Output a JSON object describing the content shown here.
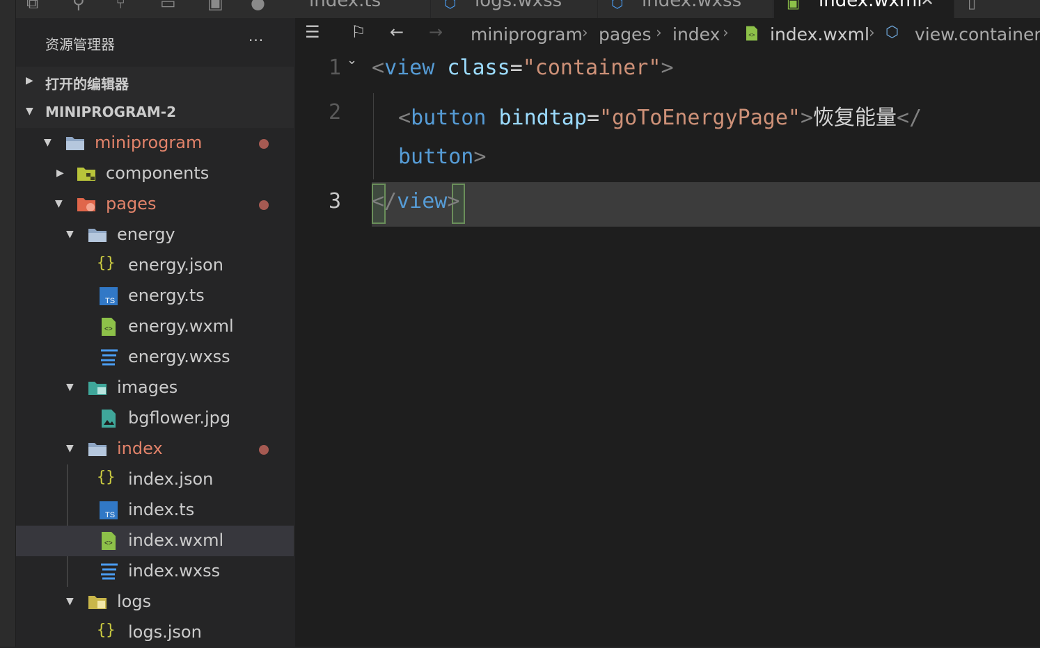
{
  "tabs": [
    {
      "label": "index.ts",
      "icon": "ts-file-icon",
      "active": false
    },
    {
      "label": "logs.wxss",
      "icon": "css-file-icon",
      "active": false
    },
    {
      "label": "index.wxss",
      "icon": "css-file-icon",
      "active": false
    },
    {
      "label": "index.wxml",
      "icon": "wxml-file-icon",
      "active": true,
      "close": "✕"
    }
  ],
  "explorer": {
    "title": "资源管理器",
    "more": "···",
    "open_editors": "打开的编辑器",
    "project": "MINIPROGRAM-2",
    "tree": [
      {
        "name": "miniprogram",
        "type": "folder",
        "modified": true
      },
      {
        "name": "components",
        "type": "folder"
      },
      {
        "name": "pages",
        "type": "folder",
        "modified": true
      },
      {
        "name": "energy",
        "type": "folder"
      },
      {
        "name": "energy.json",
        "type": "json"
      },
      {
        "name": "energy.ts",
        "type": "ts"
      },
      {
        "name": "energy.wxml",
        "type": "wxml"
      },
      {
        "name": "energy.wxss",
        "type": "wxss"
      },
      {
        "name": "images",
        "type": "folder"
      },
      {
        "name": "bgflower.jpg",
        "type": "image"
      },
      {
        "name": "index",
        "type": "folder",
        "modified": true
      },
      {
        "name": "index.json",
        "type": "json"
      },
      {
        "name": "index.ts",
        "type": "ts"
      },
      {
        "name": "index.wxml",
        "type": "wxml",
        "selected": true
      },
      {
        "name": "index.wxss",
        "type": "wxss"
      },
      {
        "name": "logs",
        "type": "folder"
      },
      {
        "name": "logs.json",
        "type": "json"
      }
    ]
  },
  "breadcrumb": [
    "miniprogram",
    "pages",
    "index",
    "index.wxml",
    "view.container"
  ],
  "code": {
    "line_numbers": [
      "1",
      "2",
      "3"
    ],
    "l1_open": "<",
    "l1_tag": "view",
    "l1_attr": "class",
    "l1_eq": "=",
    "l1_val": "\"container\"",
    "l1_close": ">",
    "l2_open": "<",
    "l2_tag": "button",
    "l2_attr": "bindtap",
    "l2_eq": "=",
    "l2_val": "\"goToEnergyPage\"",
    "l2_gt": ">",
    "l2_text": "恢复能量",
    "l2_endopen": "</",
    "l2b_tag": "button",
    "l2b_gt": ">",
    "l3_open": "</",
    "l3_tag": "view",
    "l3_close": ">"
  },
  "colors": {
    "modified": "#e2836a",
    "tag": "#569cd6",
    "attr": "#9cdcfe",
    "string": "#ce9178"
  }
}
